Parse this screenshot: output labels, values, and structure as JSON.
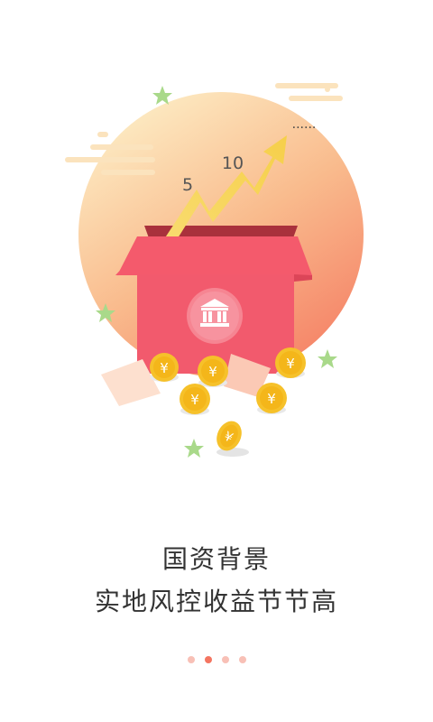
{
  "illustration": {
    "chart_labels": {
      "first": "5",
      "second": "10",
      "ellipsis": "······"
    },
    "bank_icon": "bank-icon",
    "coin_symbol": "¥",
    "colors": {
      "sun_top": "#fde7b9",
      "sun_bottom": "#f68d6a",
      "box": "#f4586b",
      "box_dark": "#c93a49",
      "arrow": "#f7d55f",
      "coin": "#f6c12a",
      "star": "#a9d98a"
    }
  },
  "slogan": {
    "line1": "国资背景",
    "line2": "实地风控收益节节高"
  },
  "pager": {
    "count": 4,
    "active_index": 1,
    "colors": {
      "active": "#f47561",
      "inactive": "#f8c0b6"
    }
  }
}
